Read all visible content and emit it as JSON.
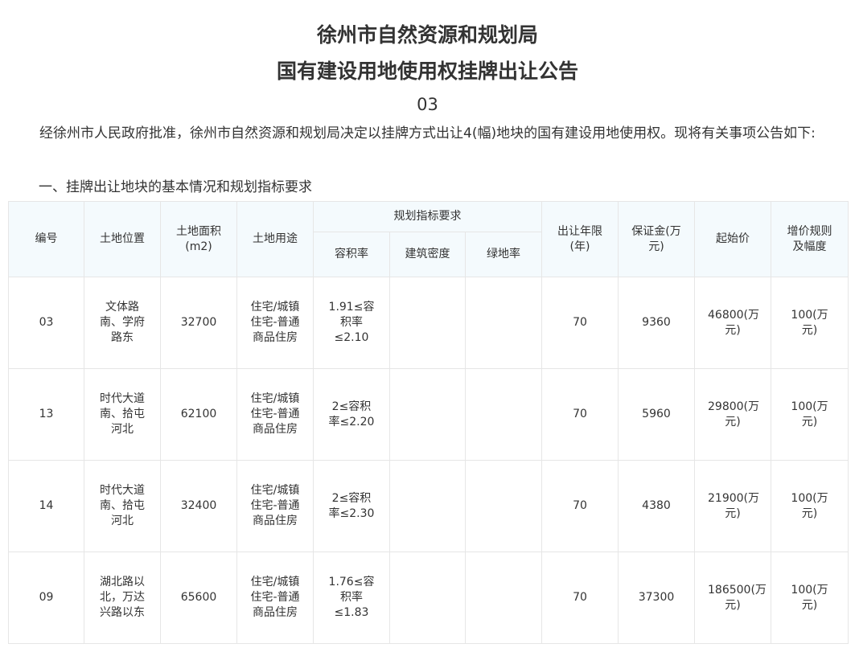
{
  "header": {
    "title_line1": "徐州市自然资源和规划局",
    "title_line2": "国有建设用地使用权挂牌出让公告",
    "number": "03"
  },
  "intro": "经徐州市人民政府批准，徐州市自然资源和规划局决定以挂牌方式出让4(幅)地块的国有建设用地使用权。现将有关事项公告如下:",
  "section_title": "一、挂牌出让地块的基本情况和规划指标要求",
  "table": {
    "headers": {
      "id": "编号",
      "location": "土地位置",
      "area": "土地面积(m2)",
      "use": "土地用途",
      "planning_group": "规划指标要求",
      "far": "容积率",
      "density": "建筑密度",
      "green": "绿地率",
      "term": "出让年限(年)",
      "deposit": "保证金(万元)",
      "start_price": "起始价",
      "increment": "增价规则及幅度"
    },
    "rows": [
      {
        "id": "03",
        "location": "文体路南、学府路东",
        "area": "32700",
        "use": "住宅/城镇住宅-普通商品住房",
        "far": "1.91≤容积率≤2.10",
        "density": "",
        "green": "",
        "term": "70",
        "deposit": "9360",
        "start_price": "46800(万元)",
        "increment": "100(万元)"
      },
      {
        "id": "13",
        "location": "时代大道南、拾屯河北",
        "area": "62100",
        "use": "住宅/城镇住宅-普通商品住房",
        "far": "2≤容积率≤2.20",
        "density": "",
        "green": "",
        "term": "70",
        "deposit": "5960",
        "start_price": "29800(万元)",
        "increment": "100(万元)"
      },
      {
        "id": "14",
        "location": "时代大道南、拾屯河北",
        "area": "32400",
        "use": "住宅/城镇住宅-普通商品住房",
        "far": "2≤容积率≤2.30",
        "density": "",
        "green": "",
        "term": "70",
        "deposit": "4380",
        "start_price": "21900(万元)",
        "increment": "100(万元)"
      },
      {
        "id": "09",
        "location": "湖北路以北，万达兴路以东",
        "area": "65600",
        "use": "住宅/城镇住宅-普通商品住房",
        "far": "1.76≤容积率≤1.83",
        "density": "",
        "green": "",
        "term": "70",
        "deposit": "37300",
        "start_price": "186500(万元)",
        "increment": "100(万元)"
      }
    ]
  }
}
